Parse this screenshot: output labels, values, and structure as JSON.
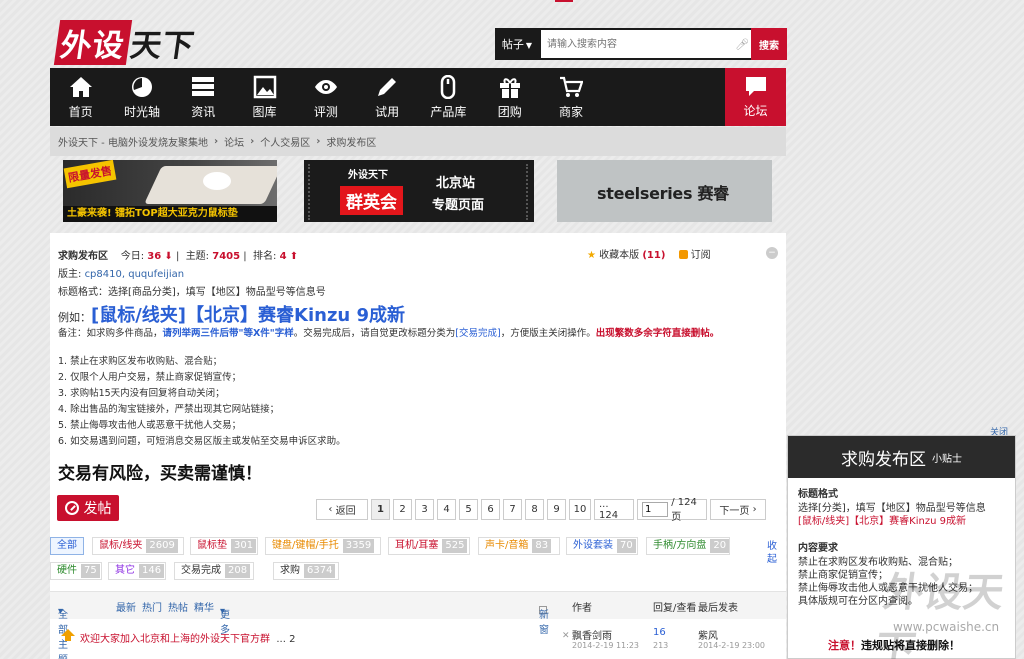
{
  "logo": {
    "text_red": "外设",
    "text_black": "天下"
  },
  "search": {
    "type_label": "帖子",
    "placeholder": "请输入搜索内容",
    "button": "搜索"
  },
  "nav": [
    {
      "label": "首页",
      "icon": "home-icon"
    },
    {
      "label": "时光轴",
      "icon": "clock-icon"
    },
    {
      "label": "资讯",
      "icon": "news-icon"
    },
    {
      "label": "图库",
      "icon": "image-icon"
    },
    {
      "label": "评测",
      "icon": "eye-icon"
    },
    {
      "label": "试用",
      "icon": "pencil-icon"
    },
    {
      "label": "产品库",
      "icon": "mouse-icon"
    },
    {
      "label": "团购",
      "icon": "gift-icon"
    },
    {
      "label": "商家",
      "icon": "cart-icon"
    }
  ],
  "nav_forum": {
    "label": "论坛",
    "icon": "chat-bubble-icon"
  },
  "breadcrumb": [
    "外设天下 - 电脑外设发烧友聚集地",
    "论坛",
    "个人交易区",
    "求购发布区"
  ],
  "banners": {
    "b1_tag": "限量发售",
    "b1_text": "土豪来袭!  镭拓TOP超大亚克力鼠标垫",
    "b2_logo": "外设天下",
    "b2_big": "群英会",
    "b2_t1": "北京站",
    "b2_t2": "专题页面",
    "b3_text": "steelseries 赛睿"
  },
  "forum": {
    "name": "求购发布区",
    "today_label": "今日:",
    "today": "36",
    "topics_label": "主题:",
    "topics": "7405",
    "rank_label": "排名:",
    "rank": "4",
    "fav_label": "收藏本版",
    "fav_count": "(11)",
    "subscribe": "订阅",
    "moderators_label": "版主:",
    "moderators": "cp8410, ququfeijian",
    "format": "标题格式：选择[商品分类]，填写【地区】物品型号等信息号",
    "example_label": "例如：",
    "example": "[鼠标/线夹]【北京】赛睿Kinzu 9成新",
    "note_pre": "备注：如求购多件商品，",
    "note_blue": "请列举两三件后带\"等X件\"字样",
    "note_mid": "。交易完成后，请自觉更改标题分类为",
    "note_link": "[交易完成]",
    "note_post": "，方便版主关闭操作。",
    "note_red": "出现繁数多余字符直接删帖。",
    "rules": [
      "1. 禁止在求购区发布收购贴、混合贴；",
      "2. 仅限个人用户交易，禁止商家促销宣传；",
      "3. 求购帖15天内没有回复将自动关闭；",
      "4. 除出售品的淘宝链接外，严禁出现其它网站链接；",
      "5. 禁止侮辱攻击他人或恶意干扰他人交易；",
      "6. 如交易遇到问题，可短消息交易区版主或发帖至交易申诉区求助。"
    ],
    "warning": "交易有风险，买卖需谨慎！",
    "post_button": "发帖"
  },
  "pager": {
    "back": "返回",
    "pages": [
      "1",
      "2",
      "3",
      "4",
      "5",
      "6",
      "7",
      "8",
      "9",
      "10"
    ],
    "last": "... 124",
    "input": "1",
    "total": "/ 124 页",
    "next": "下一页"
  },
  "tags": [
    {
      "label": "全部",
      "count": ""
    },
    {
      "label": "鼠标/线夹",
      "count": "2609",
      "color": "#c8102e"
    },
    {
      "label": "鼠标垫",
      "count": "301",
      "color": "#c8102e"
    },
    {
      "label": "键盘/键帽/手托",
      "count": "3359",
      "color": "#e88a00"
    },
    {
      "label": "耳机/耳塞",
      "count": "525",
      "color": "#c8102e"
    },
    {
      "label": "声卡/音箱",
      "count": "83",
      "color": "#e88a00"
    },
    {
      "label": "外设套装",
      "count": "70",
      "color": "#2a5fd4"
    },
    {
      "label": "手柄/方向盘",
      "count": "20",
      "color": "#2e8b2e"
    },
    {
      "label": "硬件",
      "count": "75",
      "color": "#2e8b2e"
    },
    {
      "label": "其它",
      "count": "146",
      "color": "#8a2be2"
    },
    {
      "label": "交易完成",
      "count": "208",
      "color": "#333333"
    },
    {
      "label": "求购",
      "count": "6374",
      "color": "#333333"
    }
  ],
  "collapse": "收起",
  "thead": {
    "all": "全部主题",
    "latest": "最新",
    "hot": "热门",
    "hotpost": "热帖",
    "digest": "精华",
    "more": "更多",
    "newwin": "新窗",
    "author": "作者",
    "reply": "回复/查看",
    "lastpost": "最后发表"
  },
  "thread": {
    "title": "欢迎大家加入北京和上海的外设天下官方群",
    "pages": "... 2",
    "author": "飘香剑雨",
    "date": "2014-2-19 11:23",
    "replies": "16",
    "views": "213",
    "last_author": "紫风",
    "last_date": "2014-2-19 23:00"
  },
  "side": {
    "close": "关闭",
    "title": "求购发布区",
    "subtitle": "小贴士",
    "h1": "标题格式",
    "p1": "选择[分类]，填写【地区】物品型号等信息",
    "p1_ex": "[鼠标/线夹]【北京】赛睿Kinzu 9成新",
    "h2": "内容要求",
    "p2": [
      "禁止在求购区发布收购贴、混合贴；",
      "禁止商家促销宣传；",
      "禁止侮辱攻击他人或恶意干扰他人交易；",
      "具体版规可在分区内查阅。"
    ],
    "warn_red": "注意！",
    "warn": "违规贴将直接删除！"
  },
  "watermark": {
    "text": "外设天下",
    "url": "www.pcwaishe.cn"
  }
}
